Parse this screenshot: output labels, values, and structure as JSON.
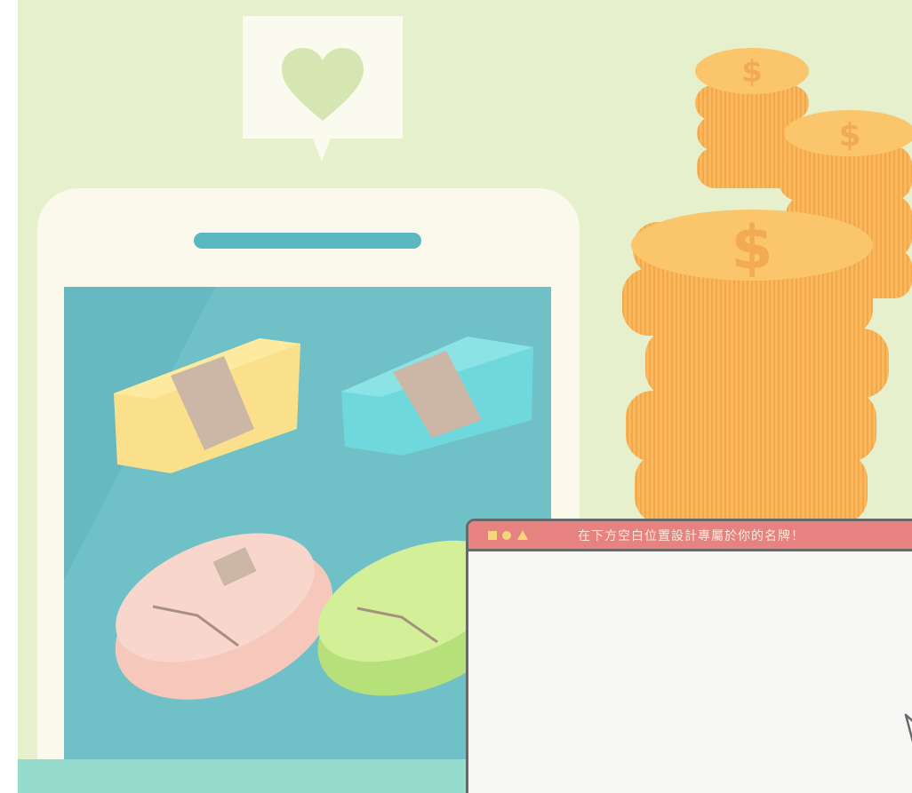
{
  "dialog": {
    "title": "在下方空白位置設計專屬於你的名牌！"
  },
  "icons": {
    "bubble": "heart-icon",
    "coins": "dollar-coin-icon",
    "dialog_controls": [
      "square-icon",
      "circle-icon",
      "triangle-icon"
    ],
    "cursor": "cursor-arrow-icon"
  },
  "colors": {
    "background": "#e6f0cc",
    "phone_screen": "#66b9c1",
    "coin": "#fbc56c",
    "dialog_bar": "#e6827f",
    "gift_yellow": "#fbe08c",
    "gift_blue": "#6fd8dd",
    "gift_pink": "#f6c8bc",
    "gift_green": "#c9e98c"
  }
}
